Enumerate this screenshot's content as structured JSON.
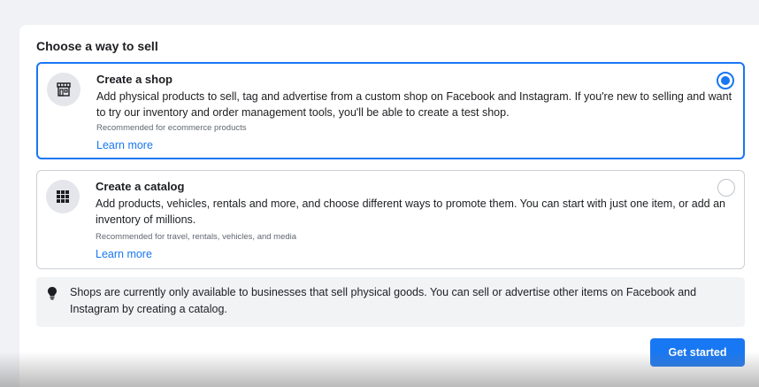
{
  "dialog": {
    "heading": "Choose a way to sell"
  },
  "options": [
    {
      "title": "Create a shop",
      "description": "Add physical products to sell, tag and advertise from a custom shop on Facebook and Instagram. If you're new to selling and want to try our inventory and order management tools, you'll be able to create a test shop.",
      "recommendation": "Recommended for ecommerce products",
      "learn_more": "Learn more",
      "icon": "storefront-icon",
      "selected": true
    },
    {
      "title": "Create a catalog",
      "description": "Add products, vehicles, rentals and more, and choose different ways to promote them. You can start with just one item, or add an inventory of millions.",
      "recommendation": "Recommended for travel, rentals, vehicles, and media",
      "learn_more": "Learn more",
      "icon": "grid-icon",
      "selected": false
    }
  ],
  "notice": {
    "icon": "lightbulb-icon",
    "text": "Shops are currently only available to businesses that sell physical goods. You can sell or advertise other items on Facebook and Instagram by creating a catalog."
  },
  "footer": {
    "get_started_label": "Get started"
  },
  "colors": {
    "accent": "#1877f2",
    "text": "#1c1e21",
    "muted": "#606770",
    "notice_bg": "#f2f3f5"
  }
}
